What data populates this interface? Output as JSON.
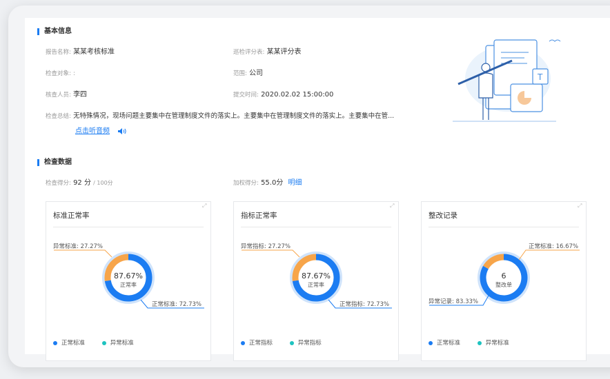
{
  "colors": {
    "accent": "#1b7cf2",
    "normal": "#1b7cf2",
    "abnormal": "#f7a54a",
    "legend_abnormal": "#1ec3c0"
  },
  "basic": {
    "title": "基本信息",
    "report_name_label": "报告名称:",
    "report_name": "某某考核标准",
    "sheet_label": "巡检评分表:",
    "sheet": "某某评分表",
    "target_label": "检查对象:",
    "target": ":",
    "scope_label": "范围:",
    "scope": "公司",
    "inspector_label": "核查人员:",
    "inspector": "李四",
    "submit_label": "提交时间:",
    "submit_time": "2020.02.02 15:00:00",
    "summary_label": "检查总结:",
    "summary": "无特殊情况，现场问题主要集中在管理制度文件的落实上。主要集中在管理制度文件的落实上。主要集中在管...",
    "listen_link": "点击听音频",
    "speaker_icon": "speaker-icon"
  },
  "check": {
    "title": "检查数据",
    "score_label": "检查得分:",
    "score": "92 分",
    "score_total": "/ 100分",
    "weighted_label": "加权得分:",
    "weighted": "55.0分",
    "detail_link": "明细"
  },
  "cards": [
    {
      "title": "标准正常率",
      "center_value": "87.67%",
      "center_label": "正常率",
      "abnormal_label": "异常标准: 27.27%",
      "normal_label": "正常标准: 72.73%",
      "legend_normal": "正常标准",
      "legend_abnormal": "异常标准"
    },
    {
      "title": "指标正常率",
      "center_value": "87.67%",
      "center_label": "正常率",
      "abnormal_label": "异常指标: 27.27%",
      "normal_label": "正常指标: 72.73%",
      "legend_normal": "正常指标",
      "legend_abnormal": "异常指标"
    },
    {
      "title": "整改记录",
      "center_value": "6",
      "center_label": "整改单",
      "abnormal_label": "正常标准: 16.67%",
      "normal_label": "异常记录: 83.33%",
      "legend_normal": "正常标准",
      "legend_abnormal": "异常标准"
    }
  ],
  "chart_data": [
    {
      "type": "pie",
      "title": "标准正常率",
      "categories": [
        "正常标准",
        "异常标准"
      ],
      "values": [
        72.73,
        27.27
      ]
    },
    {
      "type": "pie",
      "title": "指标正常率",
      "categories": [
        "正常指标",
        "异常指标"
      ],
      "values": [
        72.73,
        27.27
      ]
    },
    {
      "type": "pie",
      "title": "整改记录",
      "categories": [
        "异常记录",
        "正常标准"
      ],
      "values": [
        83.33,
        16.67
      ]
    }
  ]
}
